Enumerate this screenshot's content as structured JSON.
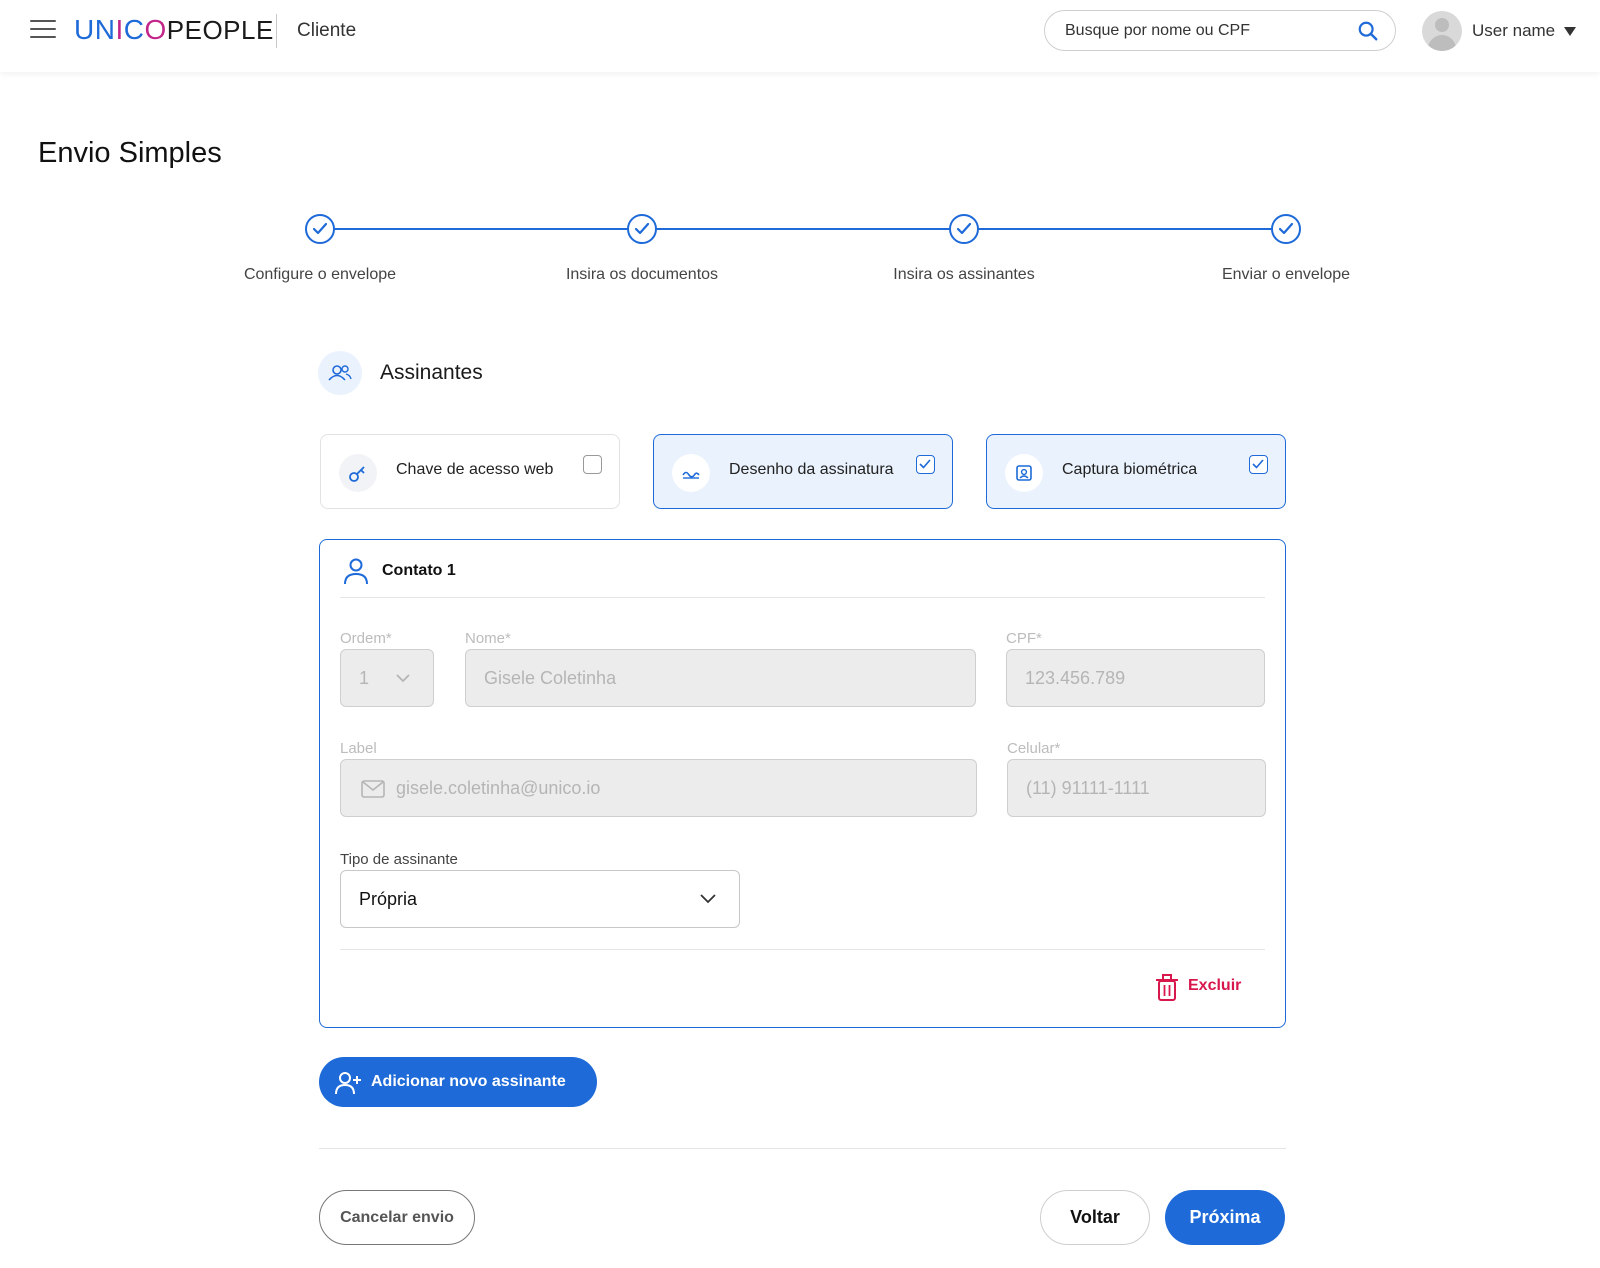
{
  "header": {
    "logo_unico_u": "U",
    "logo_unico_n": "N",
    "logo_unico_i": "I",
    "logo_unico_c": "C",
    "logo_unico_o": "O",
    "logo_people": "PEOPLE",
    "client_label": "Cliente",
    "search_placeholder": "Busque por nome ou CPF",
    "username": "User name"
  },
  "page": {
    "title": "Envio Simples"
  },
  "stepper": {
    "steps": [
      {
        "label": "Configure o envelope",
        "completed": true
      },
      {
        "label": "Insira os documentos",
        "completed": true
      },
      {
        "label": "Insira os assinantes",
        "completed": true
      },
      {
        "label": "Enviar o envelope",
        "completed": true
      }
    ]
  },
  "section": {
    "title": "Assinantes"
  },
  "options": [
    {
      "label": "Chave de acesso web",
      "checked": false,
      "icon": "key-icon"
    },
    {
      "label": "Desenho da assinatura",
      "checked": true,
      "icon": "signature-icon"
    },
    {
      "label": "Captura biométrica",
      "checked": true,
      "icon": "face-scan-icon"
    }
  ],
  "contact": {
    "title": "Contato 1",
    "order_label": "Ordem*",
    "order_value": "1",
    "name_label": "Nome*",
    "name_value": "Gisele Coletinha",
    "cpf_label": "CPF*",
    "cpf_value": "123.456.789",
    "email_label": "Label",
    "email_value": "gisele.coletinha@unico.io",
    "phone_label": "Celular*",
    "phone_value": "(11) 91111-1111",
    "type_label": "Tipo de assinante",
    "type_value": "Própria",
    "delete_label": "Excluir"
  },
  "actions": {
    "add_signer": "Adicionar novo assinante",
    "cancel": "Cancelar envio",
    "back": "Voltar",
    "next": "Próxima"
  },
  "colors": {
    "primary": "#1e6ad8",
    "danger": "#d8174c",
    "selected_bg": "#eaf2fd"
  }
}
